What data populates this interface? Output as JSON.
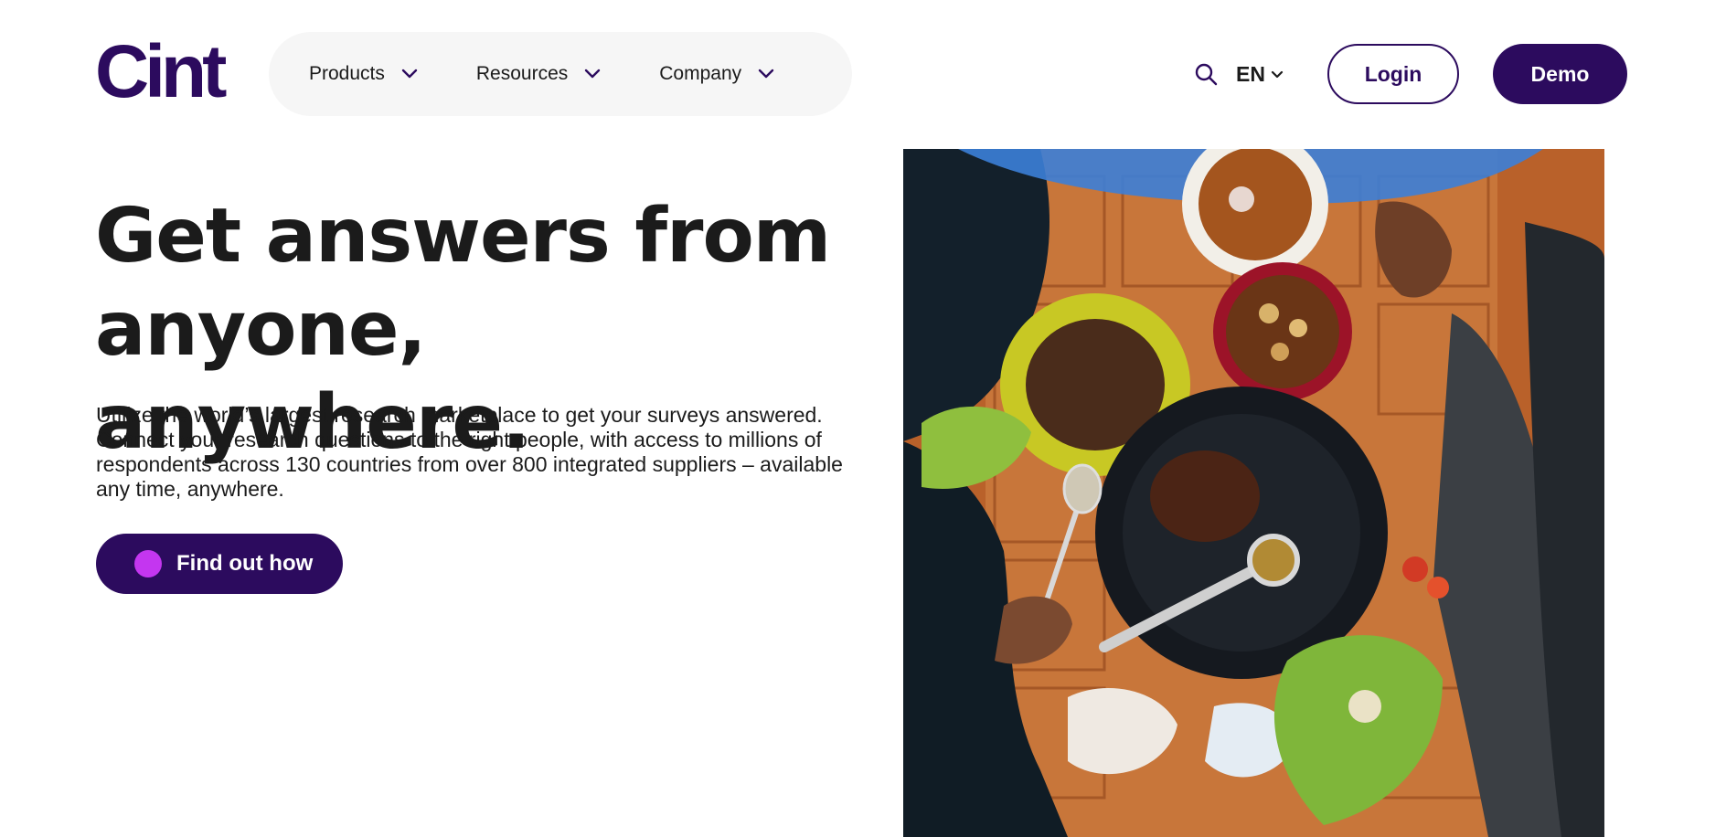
{
  "header": {
    "logo_text": "Cint",
    "nav": [
      {
        "label": "Products"
      },
      {
        "label": "Resources"
      },
      {
        "label": "Company"
      }
    ],
    "search_icon": "search-icon",
    "language": "EN",
    "login_label": "Login",
    "demo_label": "Demo"
  },
  "hero": {
    "headline_line1": "Get answers from",
    "headline_line2": "anyone, anywhere.",
    "description": "Utilize the world’s largest research marketplace to get your surveys answered. Connect your research questions to the right people, with access to millions of respondents across 130 countries from over 800 integrated suppliers – available any time, anywhere.",
    "cta_label": "Find out how"
  },
  "colors": {
    "brand": "#2c0b5e",
    "cta_dot": "#c436f0",
    "text": "#1b1b1b"
  }
}
